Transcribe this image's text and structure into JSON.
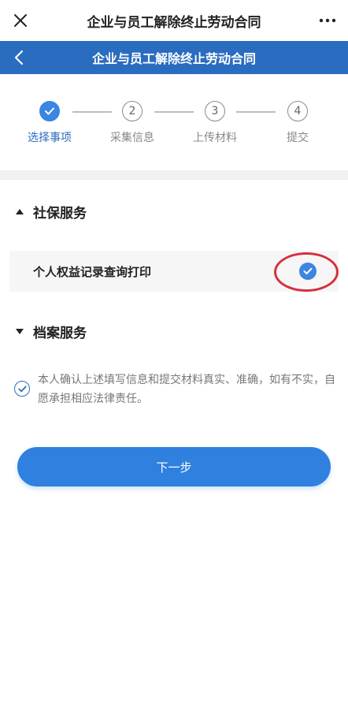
{
  "app": {
    "title": "企业与员工解除终止劳动合同"
  },
  "header": {
    "title": "企业与员工解除终止劳动合同"
  },
  "steps": [
    {
      "num": "✓",
      "label": "选择事项",
      "active": true
    },
    {
      "num": "2",
      "label": "采集信息",
      "active": false
    },
    {
      "num": "3",
      "label": "上传材料",
      "active": false
    },
    {
      "num": "4",
      "label": "提交",
      "active": false
    }
  ],
  "sections": {
    "social": {
      "title": "社保服务",
      "expanded": true,
      "items": [
        {
          "label": "个人权益记录查询打印",
          "checked": true
        }
      ]
    },
    "archive": {
      "title": "档案服务",
      "expanded": false
    }
  },
  "agreement": {
    "text": "本人确认上述填写信息和提交材料真实、准确，如有不实，自愿承担相应法律责任。",
    "checked": true
  },
  "next_button": {
    "label": "下一步"
  },
  "colors": {
    "primary": "#2a6cc0",
    "button": "#2f80df",
    "highlight_ring": "#d6303f"
  }
}
